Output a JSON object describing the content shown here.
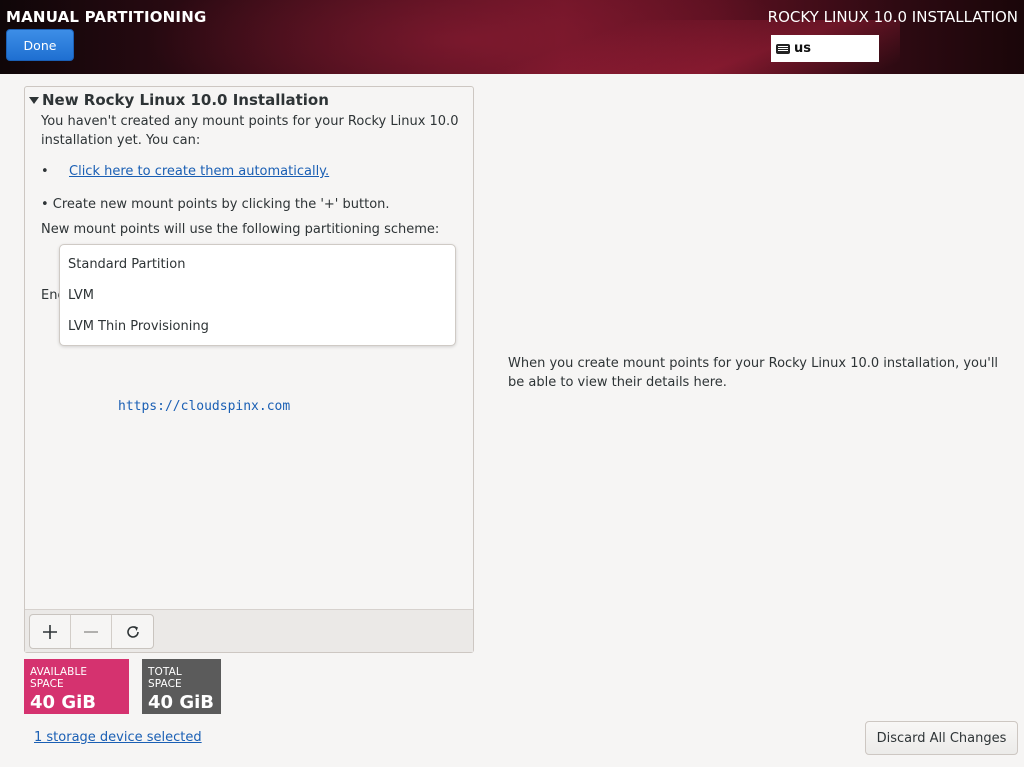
{
  "header": {
    "title": "MANUAL PARTITIONING",
    "done_label": "Done",
    "product_title": "ROCKY LINUX 10.0 INSTALLATION",
    "keyboard_layout": "us",
    "keyboard_icon": "keyboard-icon"
  },
  "panel": {
    "section_title": "New Rocky Linux 10.0 Installation",
    "intro_text": "You haven't created any mount points for your Rocky Linux 10.0 installation yet.  You can:",
    "bullet": "•",
    "auto_link": "Click here to create them automatically.",
    "manual_hint": "•  Create new mount points by clicking the '+' button.",
    "scheme_label": "New mount points will use the following partitioning scheme:",
    "encrypt_label": "Enc",
    "scheme_options": [
      "Standard Partition",
      "LVM",
      "LVM Thin Provisioning"
    ],
    "watermark": "https://cloudspinx.com",
    "toolbar": {
      "add_icon": "plus-icon",
      "remove_icon": "minus-icon",
      "reload_icon": "refresh-icon"
    }
  },
  "space": {
    "available_label": "AVAILABLE SPACE",
    "available_value": "40 GiB",
    "available_color": "#d5326f",
    "total_label": "TOTAL SPACE",
    "total_value": "40 GiB",
    "total_color": "#5b5b5b"
  },
  "storage_link": "1 storage device selected",
  "right_message": "When you create mount points for your Rocky Linux 10.0 installation, you'll be able to view their details here.",
  "discard_label": "Discard All Changes"
}
